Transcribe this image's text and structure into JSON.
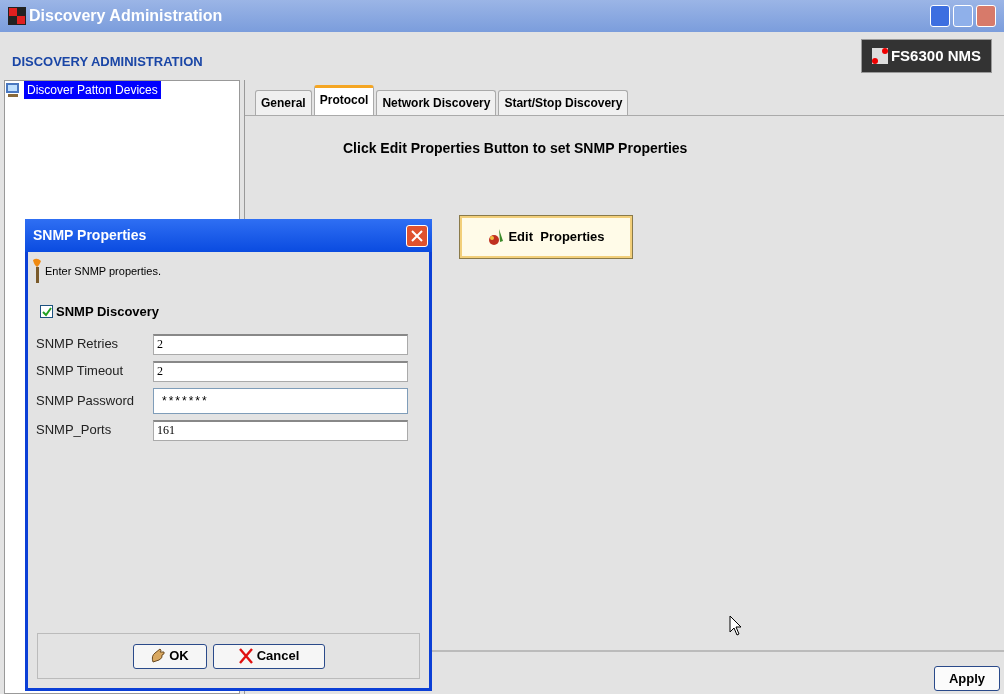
{
  "window": {
    "title": "Discovery Administration"
  },
  "header": {
    "title": "DISCOVERY ADMINISTRATION",
    "logo": "FS6300 NMS"
  },
  "tree": {
    "items": [
      {
        "label": "Discover Patton Devices",
        "selected": true
      }
    ]
  },
  "tabs": [
    {
      "label": "General",
      "selected": false
    },
    {
      "label": "Protocol",
      "selected": true
    },
    {
      "label": "Network Discovery",
      "selected": false
    },
    {
      "label": "Start/Stop Discovery",
      "selected": false
    }
  ],
  "protocol": {
    "instruction": "Click Edit Properties Button to set SNMP Properties",
    "edit_button": "Edit  Properties"
  },
  "apply_button": "Apply",
  "dialog": {
    "title": "SNMP Properties",
    "hint": "Enter SNMP properties.",
    "snmp_discovery": {
      "label": "SNMP Discovery",
      "checked": true
    },
    "fields": [
      {
        "label": "SNMP Retries",
        "value": "2",
        "kind": "text"
      },
      {
        "label": "SNMP Timeout",
        "value": "2",
        "kind": "text"
      },
      {
        "label": "SNMP Password",
        "value": "*******",
        "kind": "password"
      },
      {
        "label": "SNMP_Ports",
        "value": "161",
        "kind": "text"
      }
    ],
    "buttons": [
      {
        "label": "OK",
        "kind": "ok"
      },
      {
        "label": "Cancel",
        "kind": "cancel"
      }
    ]
  }
}
